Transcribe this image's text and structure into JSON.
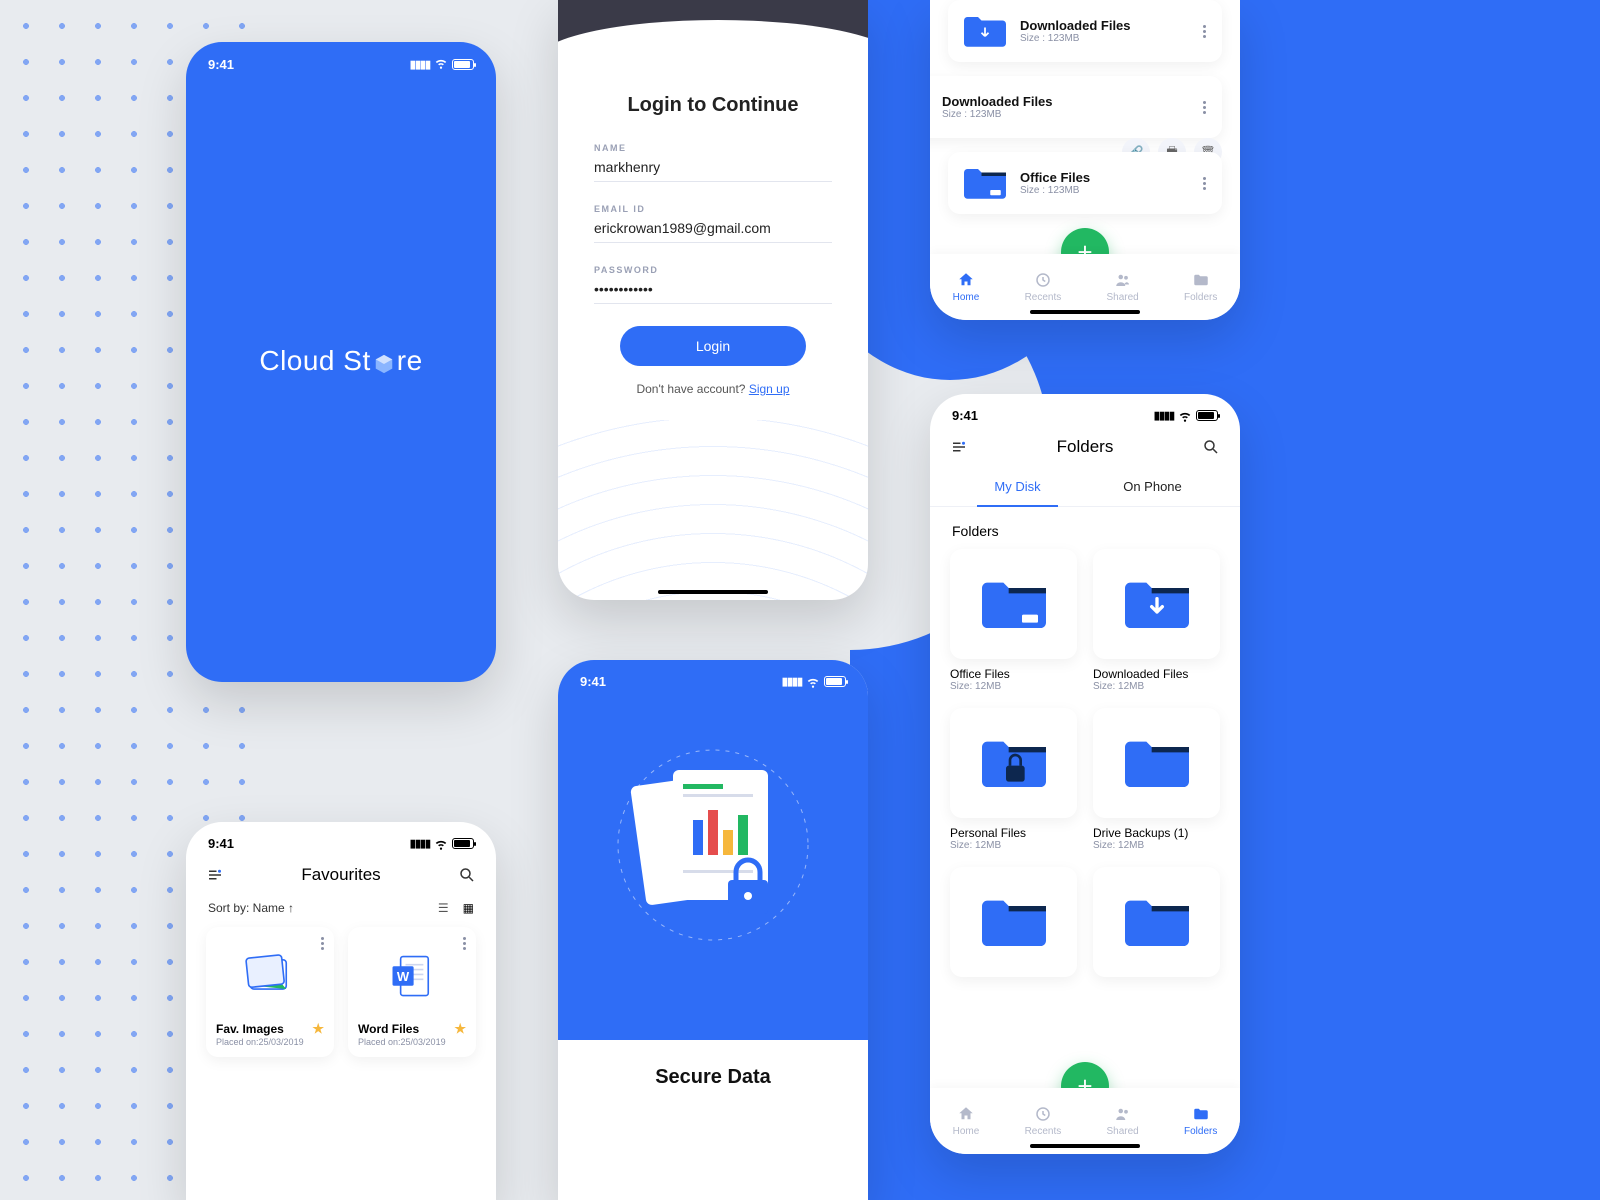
{
  "status": {
    "time": "9:41"
  },
  "splash": {
    "logo_pre": "Cloud St",
    "logo_post": "re"
  },
  "login": {
    "title": "Login to Continue",
    "name_label": "NAME",
    "name_value": "markhenry",
    "email_label": "EMAIL ID",
    "email_value": "erickrowan1989@gmail.com",
    "password_label": "PASSWORD",
    "password_value": "••••••••••••",
    "login_btn": "Login",
    "signup_text": "Don't have account? ",
    "signup_link": "Sign up"
  },
  "home": {
    "files": [
      {
        "name": "Downloaded Files",
        "size": "Size : 123MB",
        "icon": "download"
      },
      {
        "name": "Downloaded Files",
        "size": "Size : 123MB",
        "icon": "download"
      },
      {
        "name": "Office Files",
        "size": "Size : 123MB",
        "icon": "folder"
      }
    ],
    "nav": {
      "home": "Home",
      "recents": "Recents",
      "shared": "Shared",
      "folders": "Folders"
    }
  },
  "folders_screen": {
    "title": "Folders",
    "tab_mydisk": "My Disk",
    "tab_onphone": "On Phone",
    "section": "Folders",
    "items": [
      {
        "name": "Office Files",
        "size": "Size: 12MB",
        "icon": "label"
      },
      {
        "name": "Downloaded Files",
        "size": "Size: 12MB",
        "icon": "download"
      },
      {
        "name": "Personal Files",
        "size": "Size: 12MB",
        "icon": "lock"
      },
      {
        "name": "Drive Backups (1)",
        "size": "Size: 12MB",
        "icon": "plain"
      },
      {
        "name": "",
        "size": "",
        "icon": "plain"
      },
      {
        "name": "",
        "size": "",
        "icon": "plain"
      }
    ]
  },
  "favourites": {
    "title": "Favourites",
    "sort_label": "Sort by: Name ↑",
    "items": [
      {
        "name": "Fav. Images",
        "date": "Placed on:25/03/2019",
        "type": "image"
      },
      {
        "name": "Word Files",
        "date": "Placed on:25/03/2019",
        "type": "word"
      }
    ]
  },
  "secure": {
    "title": "Secure Data"
  }
}
